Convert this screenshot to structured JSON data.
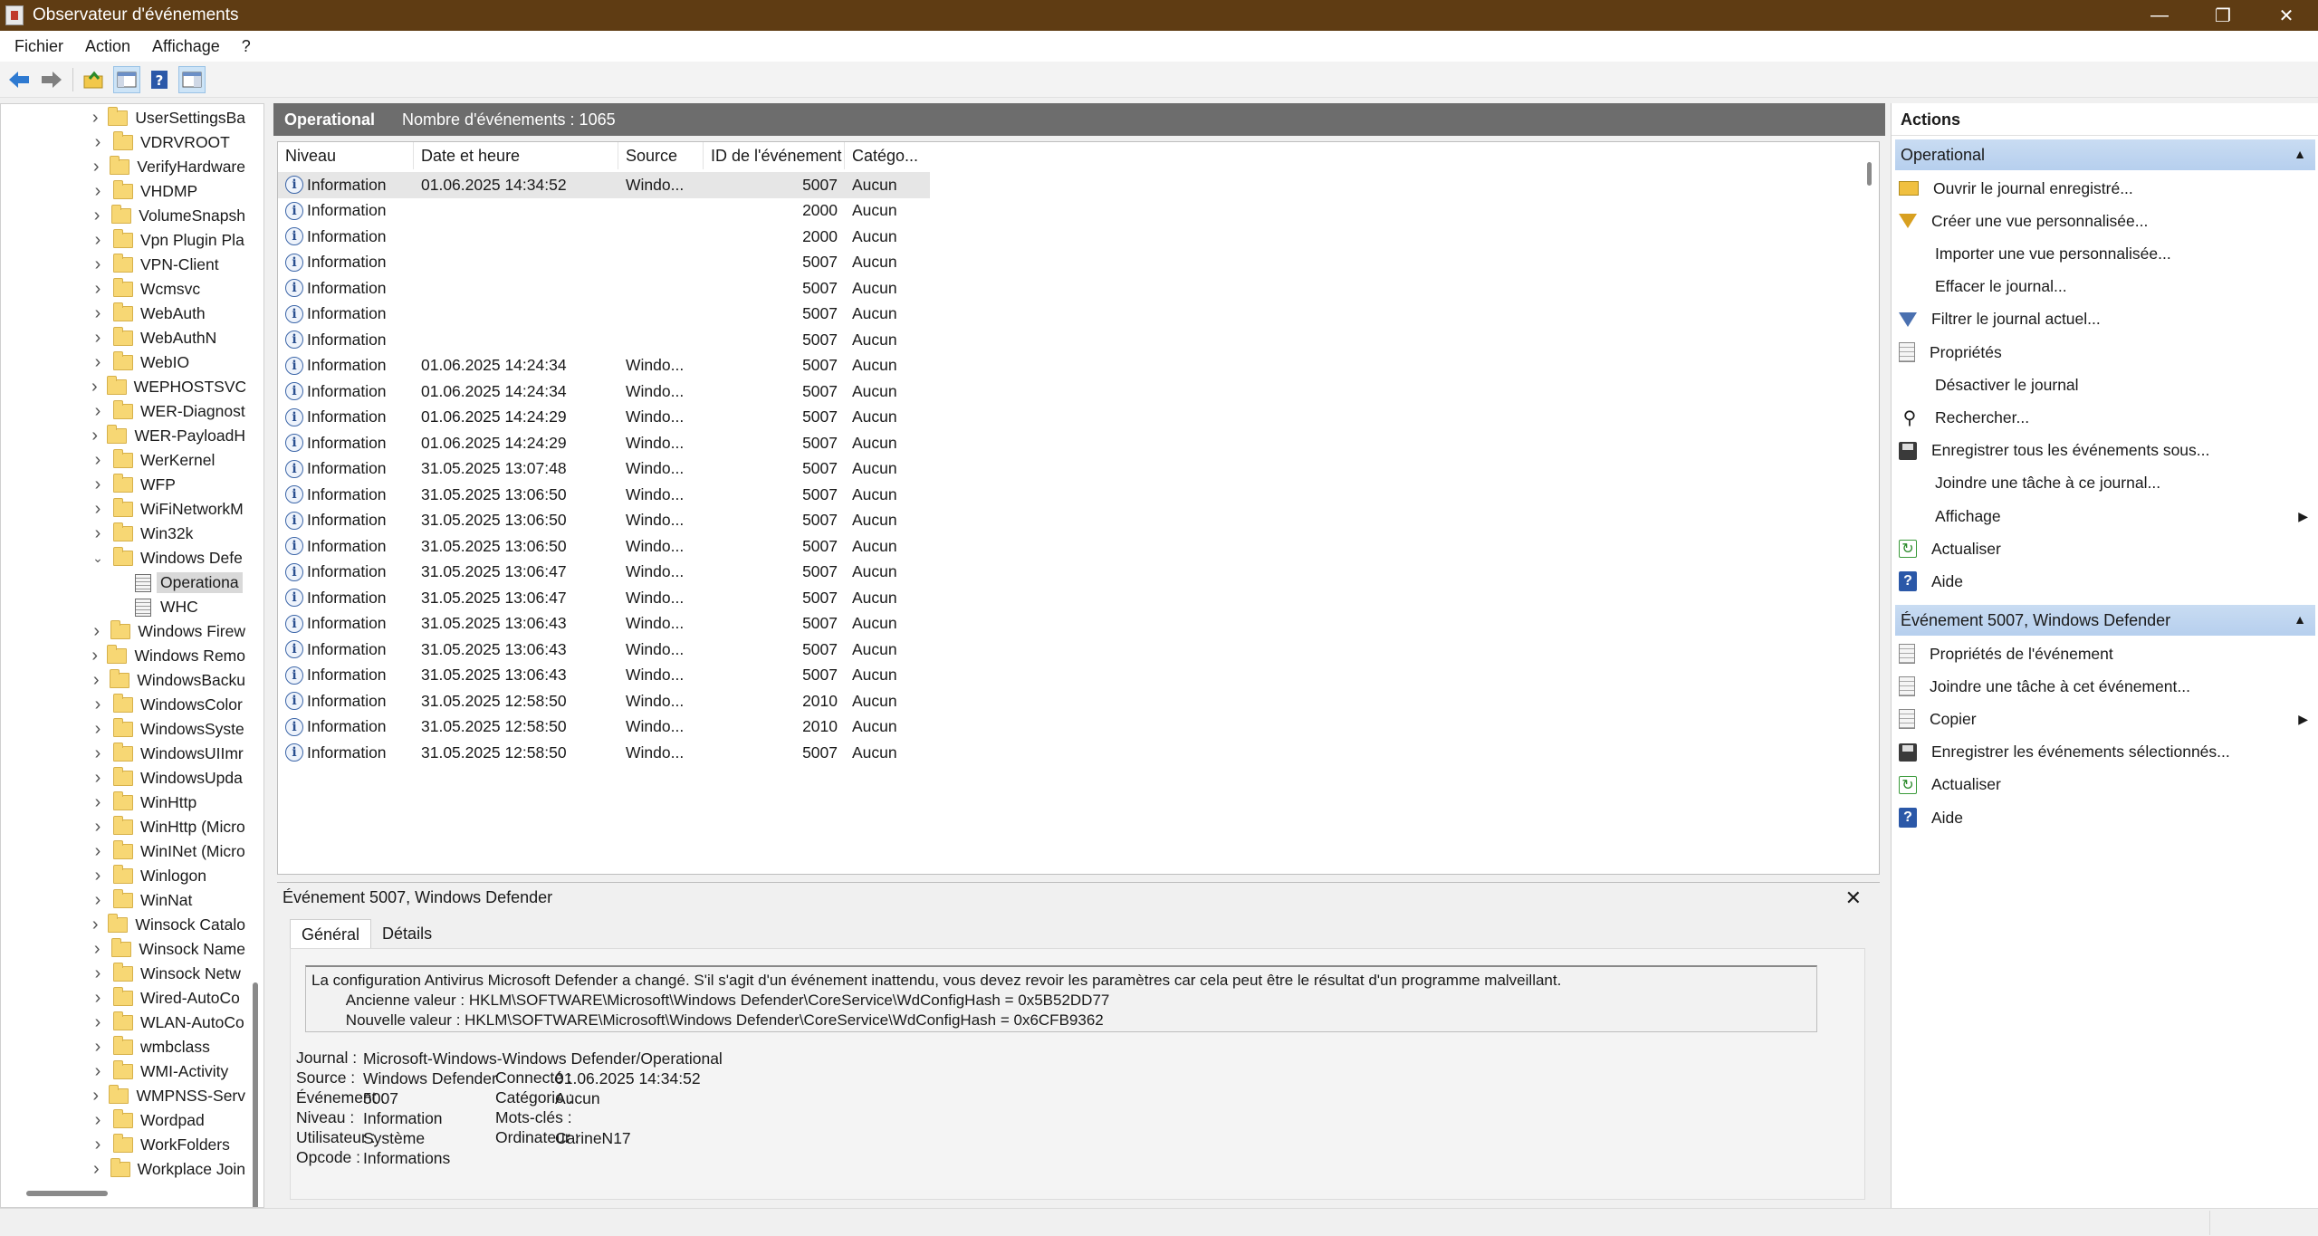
{
  "window": {
    "title": "Observateur d'événements",
    "minimize": "—",
    "maximize": "❐",
    "close": "✕"
  },
  "menu": [
    "Fichier",
    "Action",
    "Affichage",
    "?"
  ],
  "tree": {
    "items": [
      "UserSettingsBa",
      "VDRVROOT",
      "VerifyHardware",
      "VHDMP",
      "VolumeSnapsh",
      "Vpn Plugin Pla",
      "VPN-Client",
      "Wcmsvc",
      "WebAuth",
      "WebAuthN",
      "WebIO",
      "WEPHOSTSVC",
      "WER-Diagnost",
      "WER-PayloadH",
      "WerKernel",
      "WFP",
      "WiFiNetworkM",
      "Win32k",
      "Windows Defe"
    ],
    "children": [
      "Operationa",
      "WHC"
    ],
    "items_after": [
      "Windows Firew",
      "Windows Remo",
      "WindowsBacku",
      "WindowsColor",
      "WindowsSyste",
      "WindowsUIImr",
      "WindowsUpda",
      "WinHttp",
      "WinHttp (Micro",
      "WinINet (Micro",
      "Winlogon",
      "WinNat",
      "Winsock Catalo",
      "Winsock Name",
      "Winsock Netw",
      "Wired-AutoCo",
      "WLAN-AutoCo",
      "wmbclass",
      "WMI-Activity",
      "WMPNSS-Serv",
      "Wordpad",
      "WorkFolders",
      "Workplace Join"
    ]
  },
  "log": {
    "name": "Operational",
    "count_label": "Nombre d'événements : 1065"
  },
  "columns": [
    "Niveau",
    "Date et heure",
    "Source",
    "ID de l'événement",
    "Catégo..."
  ],
  "rows": [
    [
      "Information",
      "01.06.2025 14:34:52",
      "Windo...",
      "5007",
      "Aucun"
    ],
    [
      "Information",
      "",
      "",
      "2000",
      "Aucun"
    ],
    [
      "Information",
      "",
      "",
      "2000",
      "Aucun"
    ],
    [
      "Information",
      "",
      "",
      "5007",
      "Aucun"
    ],
    [
      "Information",
      "",
      "",
      "5007",
      "Aucun"
    ],
    [
      "Information",
      "",
      "",
      "5007",
      "Aucun"
    ],
    [
      "Information",
      "",
      "",
      "5007",
      "Aucun"
    ],
    [
      "Information",
      "01.06.2025 14:24:34",
      "Windo...",
      "5007",
      "Aucun"
    ],
    [
      "Information",
      "01.06.2025 14:24:34",
      "Windo...",
      "5007",
      "Aucun"
    ],
    [
      "Information",
      "01.06.2025 14:24:29",
      "Windo...",
      "5007",
      "Aucun"
    ],
    [
      "Information",
      "01.06.2025 14:24:29",
      "Windo...",
      "5007",
      "Aucun"
    ],
    [
      "Information",
      "31.05.2025 13:07:48",
      "Windo...",
      "5007",
      "Aucun"
    ],
    [
      "Information",
      "31.05.2025 13:06:50",
      "Windo...",
      "5007",
      "Aucun"
    ],
    [
      "Information",
      "31.05.2025 13:06:50",
      "Windo...",
      "5007",
      "Aucun"
    ],
    [
      "Information",
      "31.05.2025 13:06:50",
      "Windo...",
      "5007",
      "Aucun"
    ],
    [
      "Information",
      "31.05.2025 13:06:47",
      "Windo...",
      "5007",
      "Aucun"
    ],
    [
      "Information",
      "31.05.2025 13:06:47",
      "Windo...",
      "5007",
      "Aucun"
    ],
    [
      "Information",
      "31.05.2025 13:06:43",
      "Windo...",
      "5007",
      "Aucun"
    ],
    [
      "Information",
      "31.05.2025 13:06:43",
      "Windo...",
      "5007",
      "Aucun"
    ],
    [
      "Information",
      "31.05.2025 13:06:43",
      "Windo...",
      "5007",
      "Aucun"
    ],
    [
      "Information",
      "31.05.2025 12:58:50",
      "Windo...",
      "2010",
      "Aucun"
    ],
    [
      "Information",
      "31.05.2025 12:58:50",
      "Windo...",
      "2010",
      "Aucun"
    ],
    [
      "Information",
      "31.05.2025 12:58:50",
      "Windo...",
      "5007",
      "Aucun"
    ]
  ],
  "detail": {
    "title": "Événement 5007, Windows Defender",
    "tabs": [
      "Général",
      "Détails"
    ],
    "description": "La configuration Antivirus Microsoft Defender a changé. S'il s'agit d'un événement inattendu, vous devez revoir les paramètres car cela peut être le résultat d'un programme malveillant.\n\tAncienne valeur : HKLM\\SOFTWARE\\Microsoft\\Windows Defender\\CoreService\\WdConfigHash = 0x5B52DD77\n\tNouvelle valeur : HKLM\\SOFTWARE\\Microsoft\\Windows Defender\\CoreService\\WdConfigHash = 0x6CFB9362",
    "labels": {
      "journal": "Journal :",
      "source": "Source :",
      "event": "Événement :",
      "level": "Niveau :",
      "user": "Utilisateur :",
      "opcode": "Opcode :",
      "logged": "Connecté :",
      "category": "Catégorie :",
      "keywords": "Mots-clés :",
      "computer": "Ordinateur :"
    },
    "values": {
      "journal": "Microsoft-Windows-Windows Defender/Operational",
      "source": "Windows Defender",
      "event": "5007",
      "level": "Information",
      "user": "Système",
      "opcode": "Informations",
      "logged": "01.06.2025 14:34:52",
      "category": "Aucun",
      "keywords": "",
      "computer": "CarineN17"
    }
  },
  "actions": {
    "header": "Actions",
    "section1": "Operational",
    "items1": [
      {
        "label": "Ouvrir le journal enregistré...",
        "icon": "open-folder-icon"
      },
      {
        "label": "Créer une vue personnalisée...",
        "icon": "filter-create-icon"
      },
      {
        "label": "Importer une vue personnalisée...",
        "icon": ""
      },
      {
        "label": "Effacer le journal...",
        "icon": ""
      },
      {
        "label": "Filtrer le journal actuel...",
        "icon": "filter-icon"
      },
      {
        "label": "Propriétés",
        "icon": "properties-icon"
      },
      {
        "label": "Désactiver le journal",
        "icon": ""
      },
      {
        "label": "Rechercher...",
        "icon": "binoculars-icon"
      },
      {
        "label": "Enregistrer tous les événements sous...",
        "icon": "save-icon"
      },
      {
        "label": "Joindre une tâche à ce journal...",
        "icon": ""
      },
      {
        "label": "Affichage",
        "icon": "",
        "submenu": true
      },
      {
        "label": "Actualiser",
        "icon": "refresh-icon"
      },
      {
        "label": "Aide",
        "icon": "help-icon"
      }
    ],
    "section2": "Événement 5007, Windows Defender",
    "items2": [
      {
        "label": "Propriétés de l'événement",
        "icon": "properties-icon"
      },
      {
        "label": "Joindre une tâche à cet événement...",
        "icon": "task-icon"
      },
      {
        "label": "Copier",
        "icon": "copy-icon",
        "submenu": true
      },
      {
        "label": "Enregistrer les événements sélectionnés...",
        "icon": "save-icon"
      },
      {
        "label": "Actualiser",
        "icon": "refresh-icon"
      },
      {
        "label": "Aide",
        "icon": "help-icon"
      }
    ]
  }
}
